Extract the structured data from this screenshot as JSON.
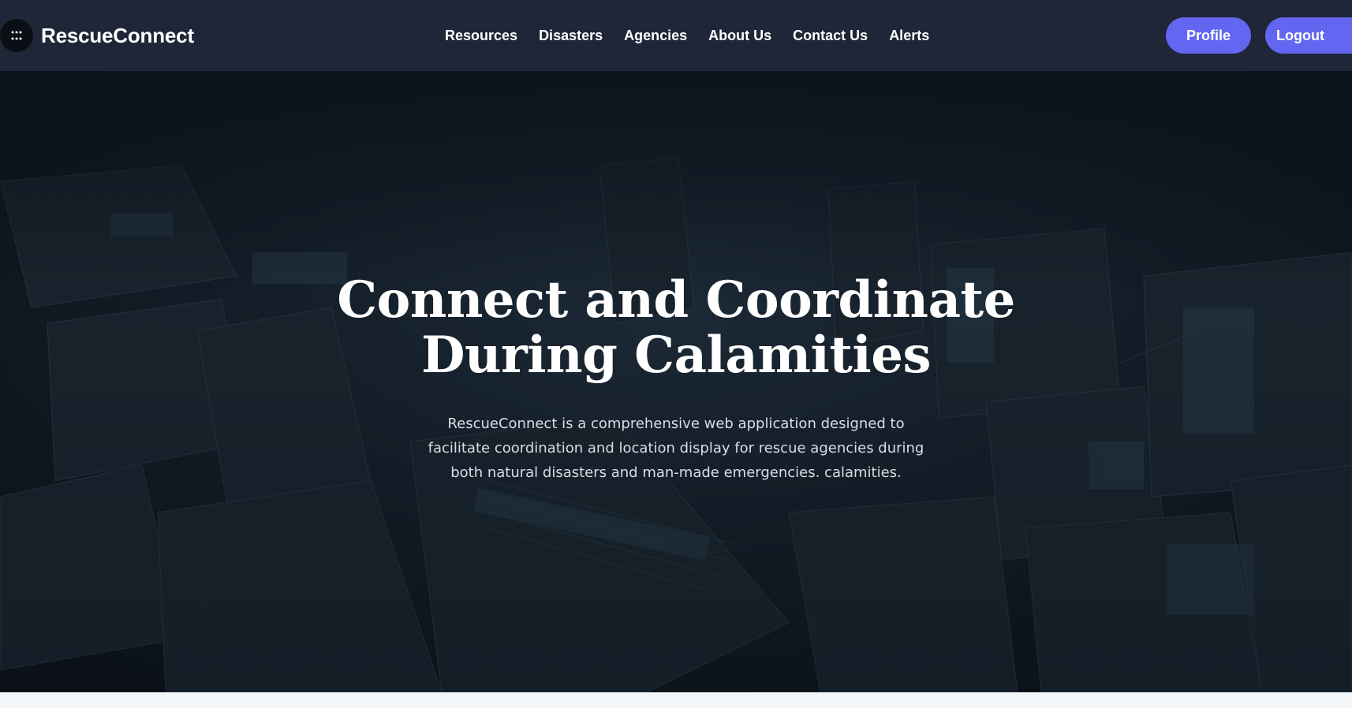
{
  "brand": {
    "name": "RescueConnect",
    "logo_icon": "grid-dots-icon"
  },
  "nav": {
    "links": [
      {
        "label": "Resources"
      },
      {
        "label": "Disasters"
      },
      {
        "label": "Agencies"
      },
      {
        "label": "About Us"
      },
      {
        "label": "Contact Us"
      },
      {
        "label": "Alerts"
      }
    ]
  },
  "actions": {
    "profile_label": "Profile",
    "logout_label": "Logout"
  },
  "hero": {
    "title_line1": "Connect and Coordinate",
    "title_line2": "During Calamities",
    "description": "RescueConnect is a comprehensive web application designed to facilitate coordination and location display for rescue agencies during both natural disasters and man-made emergencies. calamities.",
    "background": "dark-aerial-city-image"
  },
  "colors": {
    "navbar": "#1e2637",
    "accent": "#6366f1",
    "text": "#ffffff"
  }
}
